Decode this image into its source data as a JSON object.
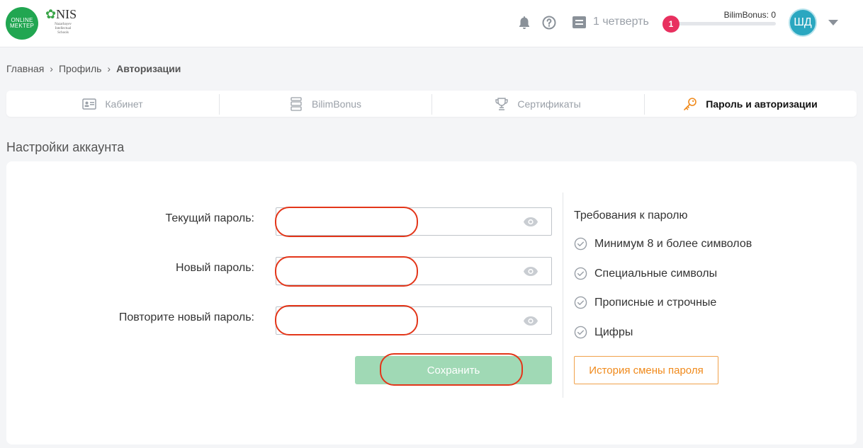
{
  "header": {
    "logo_online_mektep": {
      "line1": "ONLINE",
      "line2": "MEKTEP"
    },
    "logo_nis": {
      "mark": "NIS",
      "subtitle_line1": "Nazarbayev",
      "subtitle_line2": "Intellectual",
      "subtitle_line3": "Schools"
    },
    "notifications_icon": "bell-icon",
    "help_icon": "question-circle-icon",
    "quarter_label": "1 четверть",
    "bilimbonus": {
      "label": "BilimBonus: 0",
      "level": "1",
      "progress": 0.0
    },
    "avatar_initials": "ШД",
    "menu_icon": "caret-down-icon"
  },
  "breadcrumb": {
    "items": [
      "Главная",
      "Профиль"
    ],
    "current": "Авторизации"
  },
  "tabs": [
    {
      "label": "Кабинет",
      "icon": "id-card-icon",
      "active": false
    },
    {
      "label": "BilimBonus",
      "icon": "stack-icon",
      "active": false
    },
    {
      "label": "Сертификаты",
      "icon": "trophy-icon",
      "active": false
    },
    {
      "label": "Пароль и авторизации",
      "icon": "key-icon",
      "active": true
    }
  ],
  "section_title": "Настройки аккаунта",
  "form": {
    "current_password_label": "Текущий пароль:",
    "new_password_label": "Новый пароль:",
    "repeat_password_label": "Повторите новый пароль:",
    "current_password_value": "",
    "new_password_value": "",
    "repeat_password_value": "",
    "save_label": "Сохранить"
  },
  "requirements": {
    "title": "Требования к паролю",
    "items": [
      "Минимум 8 и более символов",
      "Специальные символы",
      "Прописные и строчные",
      "Цифры"
    ],
    "history_button_label": "История смены пароля"
  },
  "colors": {
    "brand_green": "#21a651",
    "bonus_pink": "#e8305f",
    "avatar_teal": "#2aa7c0",
    "save_button_disabled": "#a0d9b5",
    "history_button_orange": "#f08a1c",
    "highlight_red": "#e3361a",
    "active_tab_key_icon": "#f08a1c"
  }
}
